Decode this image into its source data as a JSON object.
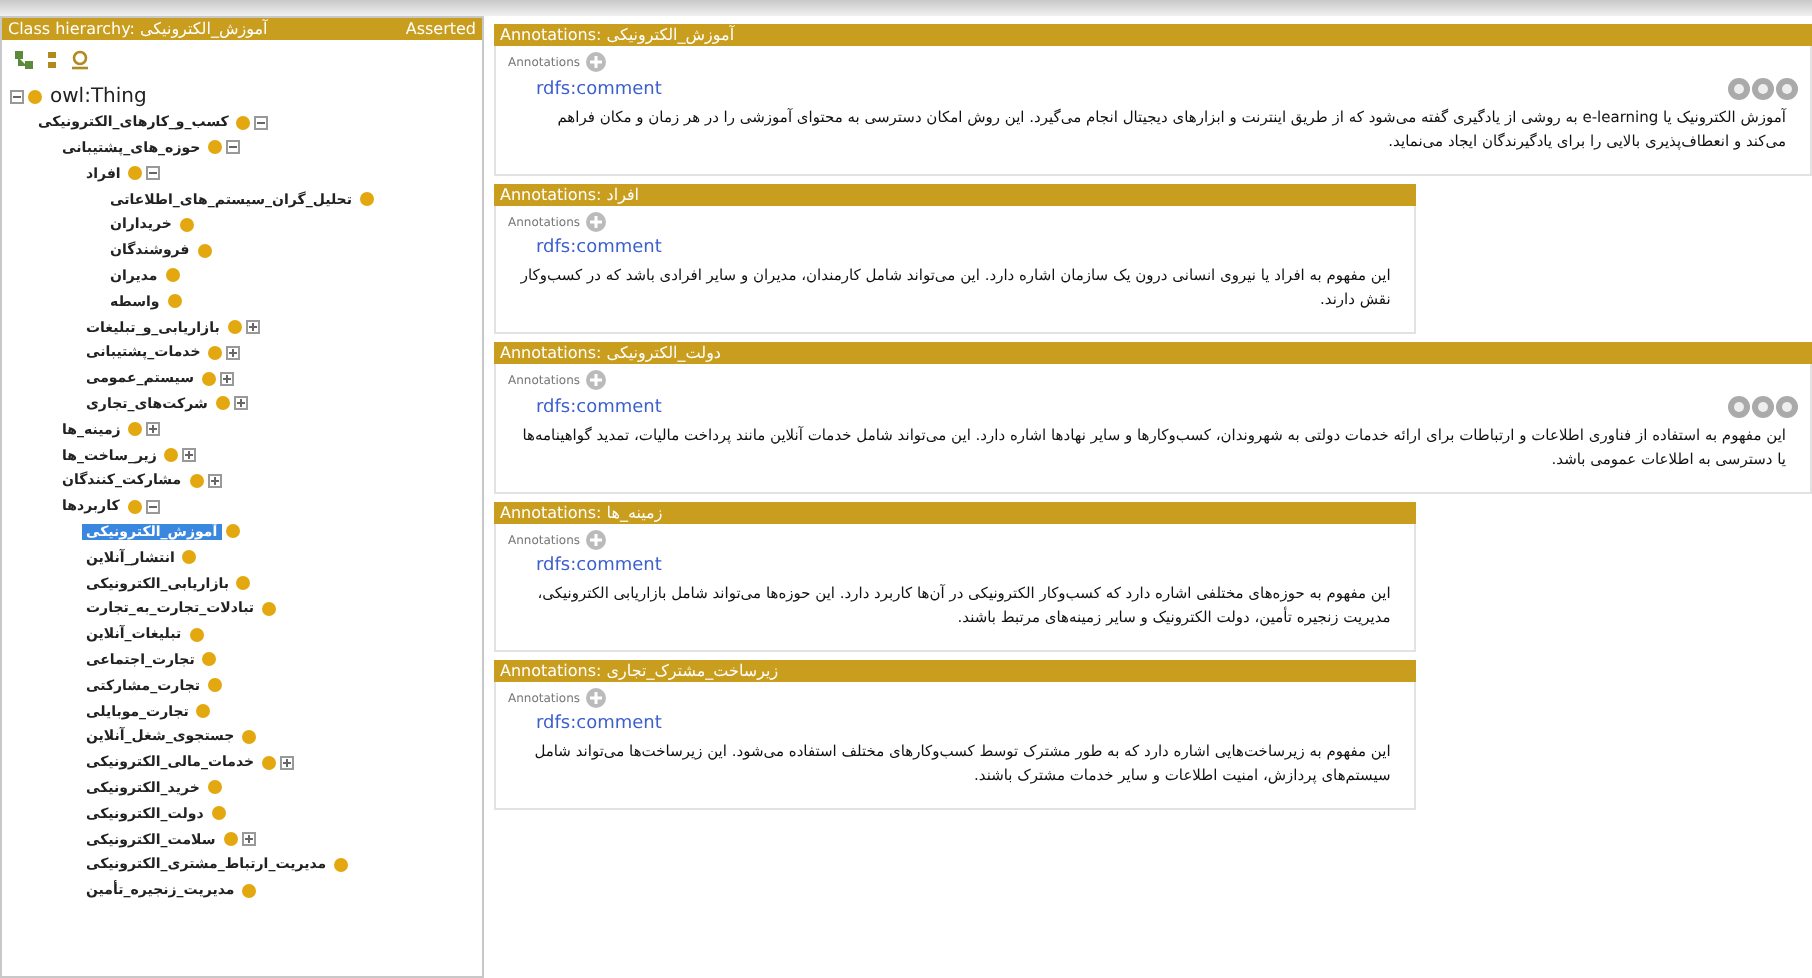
{
  "class_hierarchy": {
    "title": "Class hierarchy: آموزش_الکترونیکی",
    "mode": "Asserted",
    "tree": [
      {
        "label": "owl:Thing",
        "expanded": true,
        "selected": false,
        "children": [
          {
            "label": "کسب_و_کارهای_الکترونیکی",
            "expanded": true,
            "selected": false,
            "children": [
              {
                "label": "حوزه_های_پشتیبانی",
                "expanded": true,
                "selected": false,
                "children": [
                  {
                    "label": "افراد",
                    "expanded": true,
                    "selected": false,
                    "children": [
                      {
                        "label": "تحلیل_گران_سیستم_های_اطلاعاتی",
                        "selected": false
                      },
                      {
                        "label": "خریداران",
                        "selected": false
                      },
                      {
                        "label": "فروشندگان",
                        "selected": false
                      },
                      {
                        "label": "مدیران",
                        "selected": false
                      },
                      {
                        "label": "واسطه",
                        "selected": false
                      }
                    ]
                  },
                  {
                    "label": "بازاریابی_و_تبلیغات",
                    "expanded": false,
                    "selected": false
                  },
                  {
                    "label": "خدمات_پشتیبانی",
                    "expanded": false,
                    "selected": false
                  },
                  {
                    "label": "سیستم_عمومی",
                    "expanded": false,
                    "selected": false
                  },
                  {
                    "label": "شرکت‌های_تجاری",
                    "expanded": false,
                    "selected": false
                  }
                ]
              },
              {
                "label": "زمینه_ها",
                "expanded": false,
                "selected": false
              },
              {
                "label": "زیر_ساخت_ها",
                "expanded": false,
                "selected": false
              },
              {
                "label": "مشارکت_کنندگان",
                "expanded": false,
                "selected": false
              },
              {
                "label": "کاربردها",
                "expanded": true,
                "selected": false,
                "children": [
                  {
                    "label": "آموزش_الکترونیکی",
                    "selected": true
                  },
                  {
                    "label": "انتشار_آنلاین",
                    "selected": false
                  },
                  {
                    "label": "بازاریابی_الکترونیکی",
                    "selected": false
                  },
                  {
                    "label": "تبادلات_تجارت_به_تجارت",
                    "selected": false
                  },
                  {
                    "label": "تبلیغات_آنلاین",
                    "selected": false
                  },
                  {
                    "label": "تجارت_اجتماعی",
                    "selected": false
                  },
                  {
                    "label": "تجارت_مشارکتی",
                    "selected": false
                  },
                  {
                    "label": "تجارت_موبایلی",
                    "selected": false
                  },
                  {
                    "label": "جستجوی_شغل_آنلاین",
                    "selected": false
                  },
                  {
                    "label": "خدمات_مالی_الکترونیکی",
                    "expanded": false,
                    "selected": false
                  },
                  {
                    "label": "خرید_الکترونیکی",
                    "selected": false
                  },
                  {
                    "label": "دولت_الکترونیکی",
                    "selected": false
                  },
                  {
                    "label": "سلامت_الکترونیکی",
                    "expanded": false,
                    "selected": false
                  },
                  {
                    "label": "مدیریت_ارتباط_مشتری_الکترونیکی",
                    "selected": false
                  },
                  {
                    "label": "مدیریت_زنجیره_تأمین",
                    "selected": false
                  }
                ]
              }
            ]
          }
        ]
      }
    ]
  },
  "annotation_panels": [
    {
      "title": "Annotations: آموزش_الکترونیکی",
      "wide": true,
      "section_label": "Annotations",
      "property": "rdfs:comment",
      "text": "آموزش الکترونیک یا e-learning به روشی از یادگیری گفته می‌شود که از طریق اینترنت و ابزارهای دیجیتال انجام می‌گیرد. این روش امکان دسترسی به محتوای آموزشی را در هر زمان و مکان فراهم می‌کند و انعطاف‌پذیری بالایی را برای یادگیرندگان ایجاد می‌نماید."
    },
    {
      "title": "Annotations: افراد",
      "wide": false,
      "section_label": "Annotations",
      "property": "rdfs:comment",
      "text": "این مفهوم به افراد یا نیروی انسانی درون یک سازمان اشاره دارد. این می‌تواند شامل کارمندان، مدیران و سایر افرادی باشد که در کسب‌وکار نقش دارند."
    },
    {
      "title": "Annotations: دولت_الکترونیکی",
      "wide": true,
      "section_label": "Annotations",
      "property": "rdfs:comment",
      "text": "این مفهوم به استفاده از فناوری اطلاعات و ارتباطات برای ارائه خدمات دولتی به شهروندان، کسب‌وکارها و سایر نهادها اشاره دارد. این می‌تواند شامل خدمات آنلاین مانند پرداخت مالیات، تمدید گواهینامه‌ها یا دسترسی به اطلاعات عمومی باشد."
    },
    {
      "title": "Annotations: زمینه_ها",
      "wide": false,
      "section_label": "Annotations",
      "property": "rdfs:comment",
      "text": "این مفهوم به حوزه‌های مختلفی اشاره دارد که کسب‌وکار الکترونیکی در آن‌ها کاربرد دارد. این حوزه‌ها می‌تواند شامل بازاریابی الکترونیکی، مدیریت زنجیره تأمین، دولت الکترونیک و سایر زمینه‌های مرتبط باشند."
    },
    {
      "title": "Annotations: زیرساخت_مشترک_تجاری",
      "wide": false,
      "section_label": "Annotations",
      "property": "rdfs:comment",
      "text": "این مفهوم به زیرساخت‌هایی اشاره دارد که به طور مشترک توسط کسب‌وکارهای مختلف استفاده می‌شود. این زیرساخت‌ها می‌تواند شامل سیستم‌های پردازش، امنیت اطلاعات و سایر خدمات مشترک باشند."
    }
  ]
}
